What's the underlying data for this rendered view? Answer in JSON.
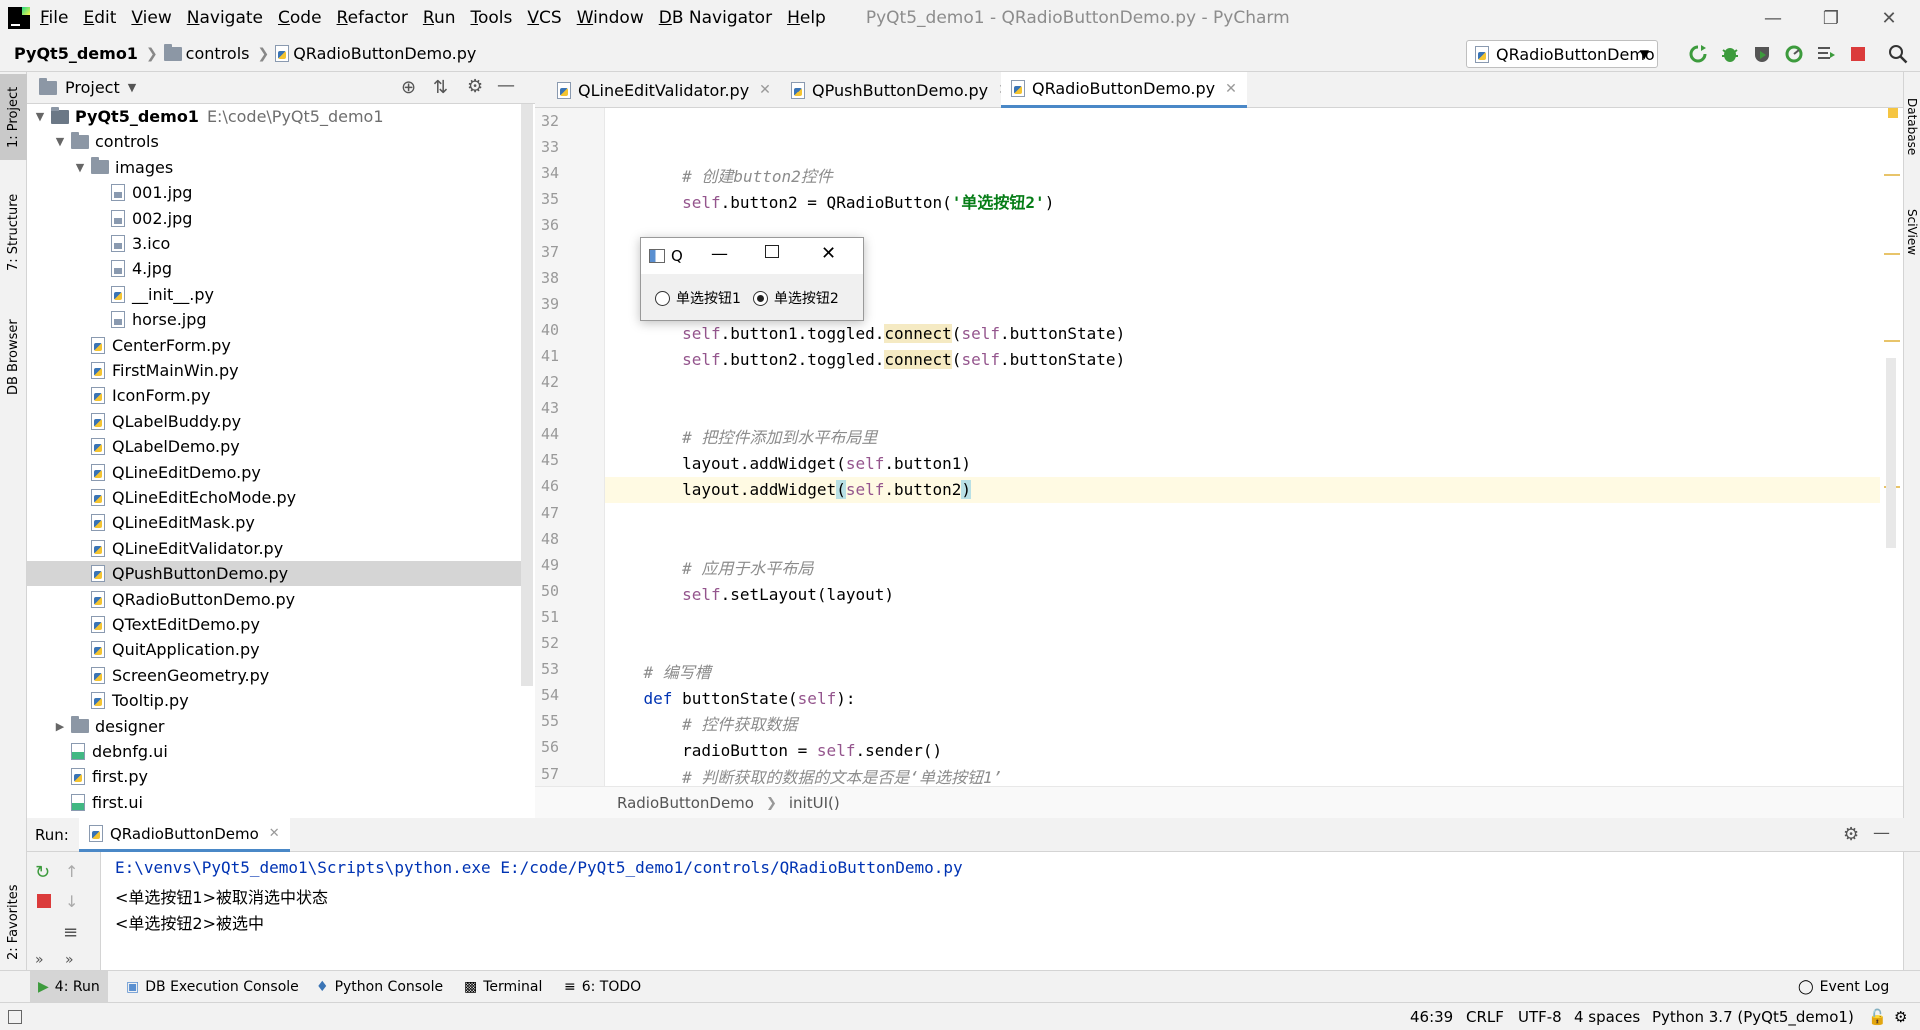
{
  "window": {
    "title": "PyQt5_demo1 - QRadioButtonDemo.py - PyCharm",
    "menu": [
      {
        "label": "File",
        "ul": "F",
        "rest": "ile"
      },
      {
        "label": "Edit",
        "ul": "E",
        "rest": "dit"
      },
      {
        "label": "View",
        "ul": "V",
        "rest": "iew"
      },
      {
        "label": "Navigate",
        "ul": "N",
        "rest": "avigate"
      },
      {
        "label": "Code",
        "ul": "C",
        "rest": "ode"
      },
      {
        "label": "Refactor",
        "ul": "R",
        "rest": "efactor"
      },
      {
        "label": "Run",
        "ul": "R",
        "rest": "un"
      },
      {
        "label": "Tools",
        "ul": "T",
        "rest": "ools"
      },
      {
        "label": "VCS",
        "ul": "V",
        "rest": "CS"
      },
      {
        "label": "Window",
        "ul": "W",
        "rest": "indow"
      },
      {
        "label": "DB Navigator",
        "ul": "D",
        "rest": "B Navigator"
      },
      {
        "label": "Help",
        "ul": "H",
        "rest": "elp"
      }
    ]
  },
  "nav": {
    "crumbs": [
      "PyQt5_demo1",
      "controls",
      "QRadioButtonDemo.py"
    ],
    "run_config": "QRadioButtonDemo"
  },
  "left_stripe": {
    "project": "1: Project",
    "structure": "7: Structure",
    "db_browser": "DB Browser",
    "favorites": "2: Favorites"
  },
  "right_stripe": {
    "database": "Database",
    "sciview": "SciView"
  },
  "project_panel": {
    "title": "Project",
    "tree": [
      {
        "label": "PyQt5_demo1",
        "hint": "E:\\code\\PyQt5_demo1",
        "indent": 0,
        "type": "root",
        "arrow": "▼",
        "bold": true
      },
      {
        "label": "controls",
        "indent": 1,
        "type": "folder",
        "arrow": "▼"
      },
      {
        "label": "images",
        "indent": 2,
        "type": "folder",
        "arrow": "▼"
      },
      {
        "label": "001.jpg",
        "indent": 3,
        "type": "img"
      },
      {
        "label": "002.jpg",
        "indent": 3,
        "type": "img"
      },
      {
        "label": "3.ico",
        "indent": 3,
        "type": "img"
      },
      {
        "label": "4.jpg",
        "indent": 3,
        "type": "img"
      },
      {
        "label": "__init__.py",
        "indent": 3,
        "type": "py"
      },
      {
        "label": "horse.jpg",
        "indent": 3,
        "type": "img"
      },
      {
        "label": "CenterForm.py",
        "indent": 2,
        "type": "py"
      },
      {
        "label": "FirstMainWin.py",
        "indent": 2,
        "type": "py"
      },
      {
        "label": "IconForm.py",
        "indent": 2,
        "type": "py"
      },
      {
        "label": "QLabelBuddy.py",
        "indent": 2,
        "type": "py"
      },
      {
        "label": "QLabelDemo.py",
        "indent": 2,
        "type": "py"
      },
      {
        "label": "QLineEditDemo.py",
        "indent": 2,
        "type": "py"
      },
      {
        "label": "QLineEditEchoMode.py",
        "indent": 2,
        "type": "py"
      },
      {
        "label": "QLineEditMask.py",
        "indent": 2,
        "type": "py"
      },
      {
        "label": "QLineEditValidator.py",
        "indent": 2,
        "type": "py"
      },
      {
        "label": "QPushButtonDemo.py",
        "indent": 2,
        "type": "py",
        "selected": true
      },
      {
        "label": "QRadioButtonDemo.py",
        "indent": 2,
        "type": "py"
      },
      {
        "label": "QTextEditDemo.py",
        "indent": 2,
        "type": "py"
      },
      {
        "label": "QuitApplication.py",
        "indent": 2,
        "type": "py"
      },
      {
        "label": "ScreenGeometry.py",
        "indent": 2,
        "type": "py"
      },
      {
        "label": "Tooltip.py",
        "indent": 2,
        "type": "py"
      },
      {
        "label": "designer",
        "indent": 1,
        "type": "folder",
        "arrow": "▶"
      },
      {
        "label": "debnfg.ui",
        "indent": 1,
        "type": "ui"
      },
      {
        "label": "first.py",
        "indent": 1,
        "type": "py"
      },
      {
        "label": "first.ui",
        "indent": 1,
        "type": "ui"
      }
    ]
  },
  "editor": {
    "tabs": [
      {
        "label": "QLineEditValidator.py",
        "active": false
      },
      {
        "label": "QPushButtonDemo.py",
        "active": false
      },
      {
        "label": "QRadioButtonDemo.py",
        "active": true
      }
    ],
    "lines": [
      {
        "n": "32",
        "html": ""
      },
      {
        "n": "33",
        "html": ""
      },
      {
        "n": "34",
        "html": "        <span class=\"cm\"># 创建button2控件</span>"
      },
      {
        "n": "35",
        "html": "        <span class=\"self\">self</span>.button2 = QRadioButton(<span class=\"str\">'单选按钮2'</span>)"
      },
      {
        "n": "36",
        "html": ""
      },
      {
        "n": "37",
        "html": ""
      },
      {
        "n": "38",
        "html": ""
      },
      {
        "n": "39",
        "html": "                <span class=\"cm\">的信号</span>"
      },
      {
        "n": "40",
        "html": "        <span class=\"self\">self</span>.button1.toggled.<span class=\"hl\">connect</span>(<span class=\"self\">self</span>.buttonState)"
      },
      {
        "n": "41",
        "html": "        <span class=\"self\">self</span>.button2.toggled.<span class=\"hl\">connect</span>(<span class=\"self\">self</span>.buttonState)"
      },
      {
        "n": "42",
        "html": ""
      },
      {
        "n": "43",
        "html": ""
      },
      {
        "n": "44",
        "html": "        <span class=\"cm\"># 把控件添加到水平布局里</span>"
      },
      {
        "n": "45",
        "html": "        layout.addWidget(<span class=\"self\">self</span>.button1)"
      },
      {
        "n": "46",
        "html": "        layout.addWidget<span class=\"brace\">(</span><span class=\"self\">self</span>.button2<span class=\"brace\">)</span>",
        "current": true
      },
      {
        "n": "47",
        "html": ""
      },
      {
        "n": "48",
        "html": ""
      },
      {
        "n": "49",
        "html": "        <span class=\"cm\"># 应用于水平布局</span>"
      },
      {
        "n": "50",
        "html": "        <span class=\"self\">self</span>.setLayout(layout)"
      },
      {
        "n": "51",
        "html": ""
      },
      {
        "n": "52",
        "html": ""
      },
      {
        "n": "53",
        "html": "    <span class=\"cm\"># 编写槽</span>"
      },
      {
        "n": "54",
        "html": "    <span class=\"kw\">def</span> buttonState(<span class=\"self\">self</span>):"
      },
      {
        "n": "55",
        "html": "        <span class=\"cm\"># 控件获取数据</span>"
      },
      {
        "n": "56",
        "html": "        radioButton = <span class=\"self\">self</span>.sender()"
      },
      {
        "n": "57",
        "html": "        <span class=\"cm\"># 判断获取的数据的文本是否是‘单选按钮1’</span>"
      }
    ],
    "breadcrumb": [
      "RadioButtonDemo",
      "initUI()"
    ]
  },
  "dialog": {
    "title": "Q",
    "radio1": "单选按钮1",
    "radio2": "单选按钮2",
    "radio2_checked": true
  },
  "run_panel": {
    "label": "Run:",
    "tab": "QRadioButtonDemo",
    "output": [
      "E:\\venvs\\PyQt5_demo1\\Scripts\\python.exe E:/code/PyQt5_demo1/controls/QRadioButtonDemo.py",
      "<单选按钮1>被取消选中状态",
      "<单选按钮2>被选中"
    ]
  },
  "tool_tabs": {
    "run": "4: Run",
    "db_console": "DB Execution Console",
    "python_console": "Python Console",
    "terminal": "Terminal",
    "todo": "6: TODO",
    "event_log": "Event Log"
  },
  "status": {
    "position": "46:39",
    "line_sep": "CRLF",
    "encoding": "UTF-8",
    "indent": "4 spaces",
    "interpreter": "Python 3.7 (PyQt5_demo1)"
  }
}
